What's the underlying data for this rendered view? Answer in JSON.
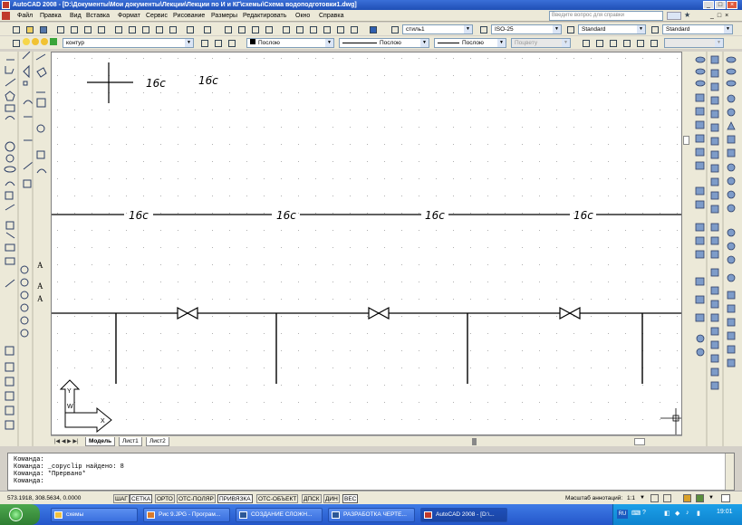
{
  "window": {
    "title": "AutoCAD 2008 - [D:\\Документы\\Мои документы\\Лекции\\Лекции по И и КГ\\схемы\\Схема водоподготовки1.dwg]"
  },
  "menu": [
    "Файл",
    "Правка",
    "Вид",
    "Вставка",
    "Формат",
    "Сервис",
    "Рисование",
    "Размеры",
    "Редактировать",
    "Окно",
    "Справка"
  ],
  "search": {
    "placeholder": "Введите вопрос для справки"
  },
  "toolbar_styles": {
    "text_style": "стиль1",
    "dim_style": "ISO-25",
    "table_style": "Standard",
    "mleader_style": "Standard"
  },
  "toolbar_layers": {
    "layer": "контур",
    "color": "Послою",
    "linetype": "Послою",
    "lineweight": "Послою",
    "plotstyle": "Поцвету"
  },
  "drawing": {
    "labels": {
      "legend_top_1": "16с",
      "legend_top_2": "16с",
      "pipe_1": "16с",
      "pipe_2": "16с",
      "pipe_3": "16с",
      "pipe_4": "16с"
    },
    "ucs": {
      "y_label": "Y",
      "w_label": "W",
      "x_label": "X"
    }
  },
  "layout_tabs": [
    "Модель",
    "Лист1",
    "Лист2"
  ],
  "command_window": {
    "lines": [
      "Команда:",
      "Команда: _copyclip найдено: 8",
      "Команда: *Прервано*",
      "Команда:"
    ]
  },
  "status": {
    "coords": "573.1918, 308.5634, 0.0000",
    "toggles": [
      "ШАГ",
      "СЕТКА",
      "ОРТО",
      "ОТС-ПОЛЯР",
      "ПРИВЯЗКА",
      "ОТС-ОБЪЕКТ",
      "ДПСК",
      "ДИН",
      "ВЕС"
    ],
    "annotation_scale_label": "Масштаб аннотаций:",
    "annotation_scale_value": "1:1"
  },
  "taskbar": {
    "tasks": [
      {
        "label": "схемы",
        "active": false
      },
      {
        "label": "Рис 9.JPG - Програм...",
        "active": false
      },
      {
        "label": "СОЗДАНИЕ СЛОЖН...",
        "active": false
      },
      {
        "label": "РАЗРАБОТКА ЧЕРТЕ...",
        "active": false
      },
      {
        "label": "AutoCAD 2008 - [D:\\...",
        "active": true
      }
    ],
    "language": "RU",
    "clock": "19:01"
  }
}
